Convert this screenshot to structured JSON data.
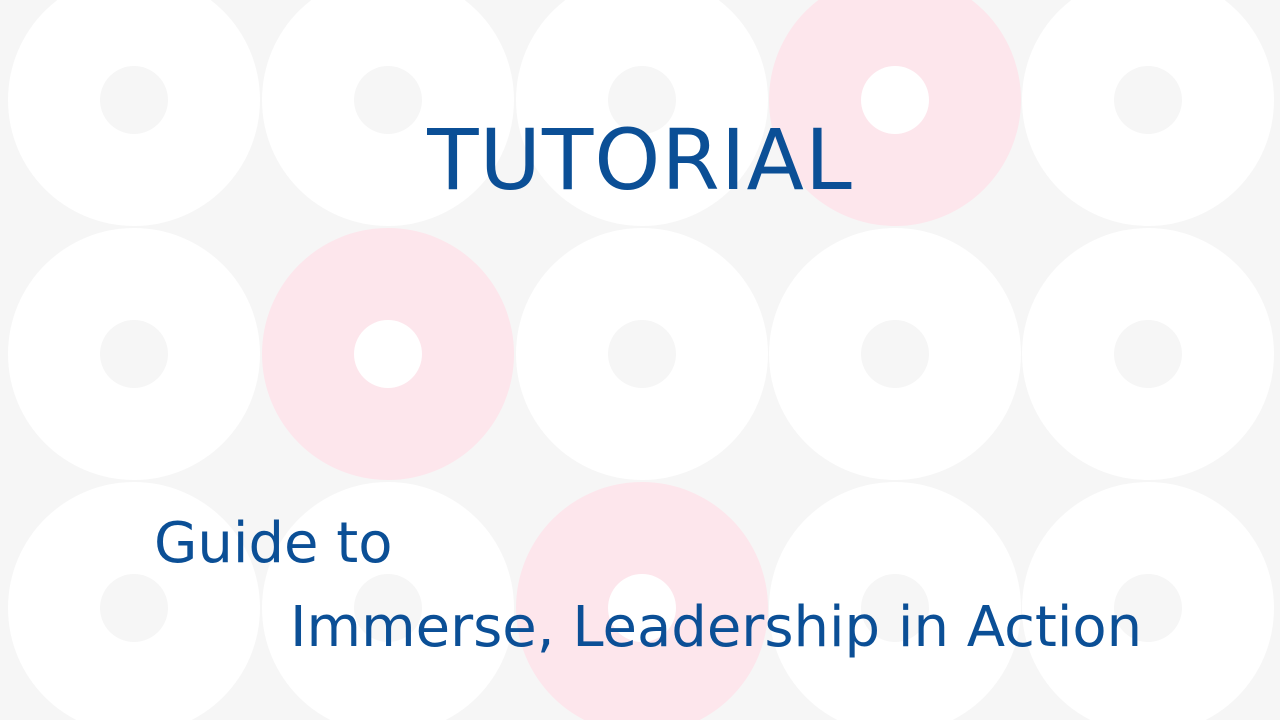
{
  "slide": {
    "title": "TUTORIAL",
    "subtitle_line1": "Guide to",
    "subtitle_line2": "Immerse, Leadership in Action"
  },
  "colors": {
    "background": "#f6f6f6",
    "ring_white": "#ffffff",
    "ring_pink": "#fde6ec",
    "text_blue": "#0b4f96"
  },
  "decor": {
    "pattern": "grid-of-rings",
    "pink_rings": [
      {
        "row": 0,
        "col": 3
      },
      {
        "row": 1,
        "col": 1
      },
      {
        "row": 2,
        "col": 2
      }
    ]
  }
}
